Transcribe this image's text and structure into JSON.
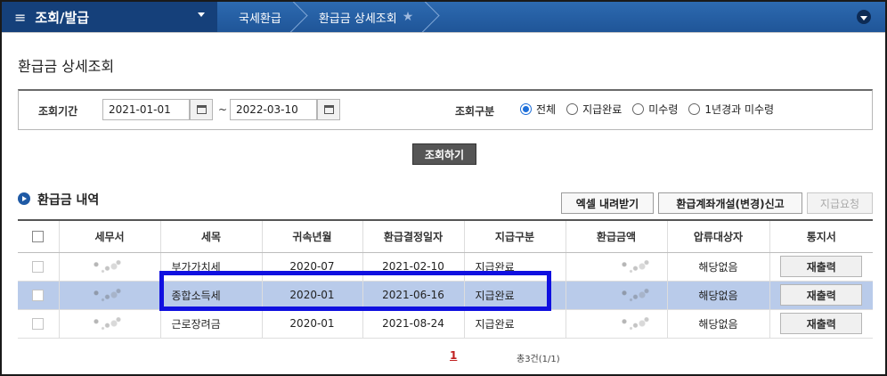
{
  "nav": {
    "menu_label": "조회/발급",
    "crumbs": [
      "국세환급",
      "환급금 상세조회"
    ]
  },
  "page_title": "환급금 상세조회",
  "search": {
    "period_label": "조회기간",
    "date_from": "2021-01-01",
    "tilde": "~",
    "date_to": "2022-03-10",
    "category_label": "조회구분",
    "options": [
      "전체",
      "지급완료",
      "미수령",
      "1년경과 미수령"
    ],
    "selected": "전체",
    "submit_label": "조회하기"
  },
  "section": {
    "title": "환급금 내역",
    "buttons": {
      "excel": "엑셀 내려받기",
      "account": "환급계좌개설(변경)신고",
      "request": "지급요청"
    }
  },
  "table": {
    "headers": [
      "세무서",
      "세목",
      "귀속년월",
      "환급결정일자",
      "지급구분",
      "환급금액",
      "압류대상자",
      "통지서"
    ],
    "rows": [
      {
        "tax": "부가가치세",
        "period": "2020-07",
        "decision_date": "2021-02-10",
        "status": "지급완료",
        "seizure": "해당없음",
        "action": "재출력",
        "selected": false
      },
      {
        "tax": "종합소득세",
        "period": "2020-01",
        "decision_date": "2021-06-16",
        "status": "지급완료",
        "seizure": "해당없음",
        "action": "재출력",
        "selected": true
      },
      {
        "tax": "근로장려금",
        "period": "2020-01",
        "decision_date": "2021-08-24",
        "status": "지급완료",
        "seizure": "해당없음",
        "action": "재출력",
        "selected": false
      }
    ]
  },
  "pagination": {
    "current": "1",
    "total_text": "총3건(1/1)"
  }
}
